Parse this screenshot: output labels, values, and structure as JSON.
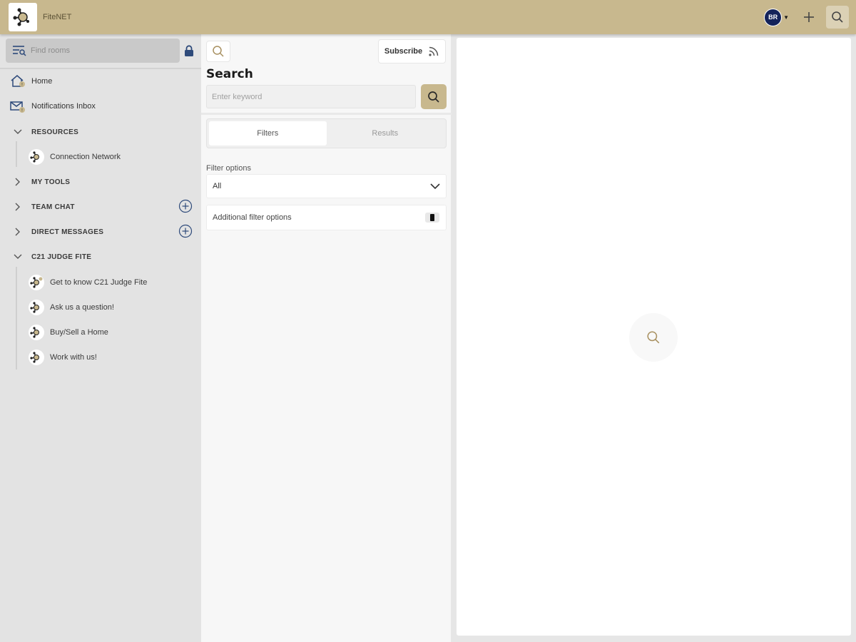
{
  "app": {
    "name": "FiteNET"
  },
  "user": {
    "initials": "BR"
  },
  "colors": {
    "accent": "#c8b88e",
    "avatar": "#14235a",
    "lock": "#2e4a7a",
    "icon_gold": "#a89060"
  },
  "sidebar": {
    "search_placeholder": "Find rooms",
    "items": [
      {
        "label": "Home",
        "icon": "home-icon"
      },
      {
        "label": "Notifications Inbox",
        "icon": "envelope-icon"
      }
    ],
    "sections": [
      {
        "label": "RESOURCES",
        "expanded": true,
        "rooms": [
          "Connection Network"
        ]
      },
      {
        "label": "MY TOOLS",
        "expanded": false
      },
      {
        "label": "TEAM CHAT",
        "expanded": false,
        "addable": true
      },
      {
        "label": "DIRECT MESSAGES",
        "expanded": false,
        "addable": true
      },
      {
        "label": "C21 JUDGE FITE",
        "expanded": true,
        "rooms": [
          "Get to know C21 Judge Fite",
          "Ask us a question!",
          "Buy/Sell a Home",
          "Work with us!"
        ]
      }
    ]
  },
  "search_panel": {
    "title": "Search",
    "subscribe_label": "Subscribe",
    "keyword_placeholder": "Enter keyword",
    "tabs": [
      {
        "label": "Filters",
        "active": true
      },
      {
        "label": "Results",
        "active": false
      }
    ],
    "filter_options_label": "Filter options",
    "filter_options_value": "All",
    "additional_filter_label": "Additional filter options"
  }
}
